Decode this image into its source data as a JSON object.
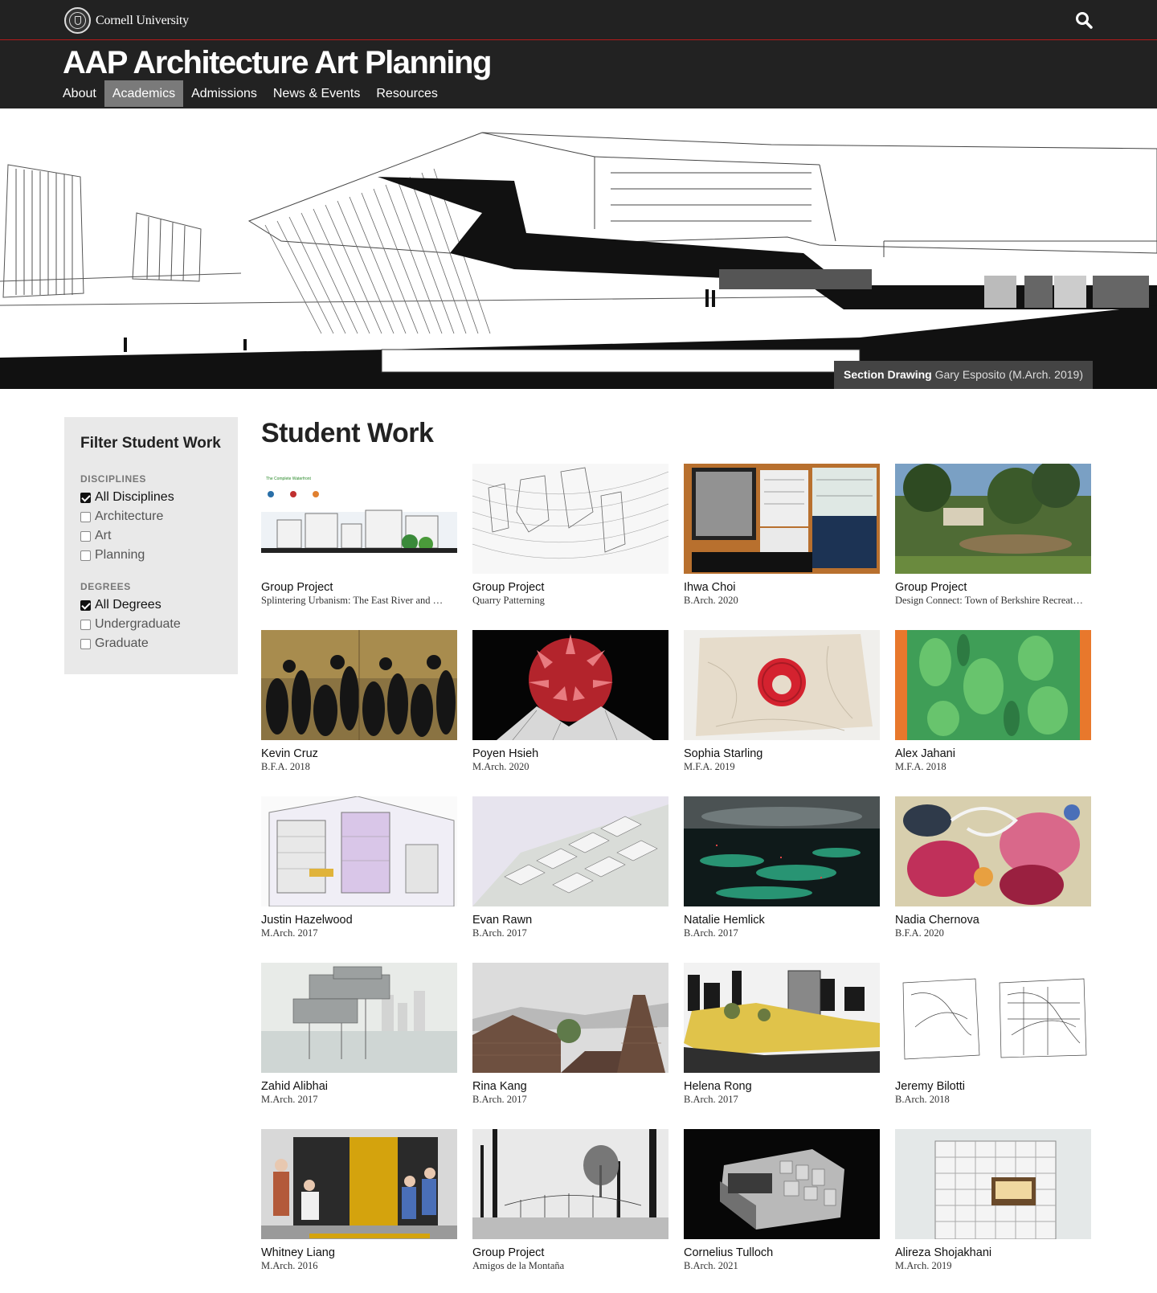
{
  "cornell": {
    "name": "Cornell University"
  },
  "header": {
    "title": "AAP Architecture Art Planning"
  },
  "nav": [
    {
      "label": "About",
      "active": false
    },
    {
      "label": "Academics",
      "active": true
    },
    {
      "label": "Admissions",
      "active": false
    },
    {
      "label": "News & Events",
      "active": false
    },
    {
      "label": "Resources",
      "active": false
    }
  ],
  "hero": {
    "caption_title": "Section Drawing",
    "caption_credit": "Gary Esposito (M.Arch. 2019)"
  },
  "filter": {
    "title": "Filter Student Work",
    "disciplines_heading": "DISCIPLINES",
    "disciplines": [
      {
        "label": "All Disciplines",
        "checked": true
      },
      {
        "label": "Architecture",
        "checked": false
      },
      {
        "label": "Art",
        "checked": false
      },
      {
        "label": "Planning",
        "checked": false
      }
    ],
    "degrees_heading": "DEGREES",
    "degrees": [
      {
        "label": "All Degrees",
        "checked": true
      },
      {
        "label": "Undergraduate",
        "checked": false
      },
      {
        "label": "Graduate",
        "checked": false
      }
    ]
  },
  "main": {
    "title": "Student Work"
  },
  "works": [
    {
      "name": "Group Project",
      "sub": "Splintering Urbanism: The East River and …",
      "theme": "waterfront"
    },
    {
      "name": "Group Project",
      "sub": "Quarry Patterning",
      "theme": "sketch"
    },
    {
      "name": "Ihwa Choi",
      "sub": "B.Arch. 2020",
      "theme": "table"
    },
    {
      "name": "Group Project",
      "sub": "Design Connect: Town of Berkshire Recreat…",
      "theme": "park"
    },
    {
      "name": "Kevin Cruz",
      "sub": "B.F.A. 2018",
      "theme": "shadow"
    },
    {
      "name": "Poyen Hsieh",
      "sub": "M.Arch. 2020",
      "theme": "spiky"
    },
    {
      "name": "Sophia Starling",
      "sub": "M.F.A. 2019",
      "theme": "cloth"
    },
    {
      "name": "Alex Jahani",
      "sub": "M.F.A. 2018",
      "theme": "paint"
    },
    {
      "name": "Justin Hazelwood",
      "sub": "M.Arch. 2017",
      "theme": "axon"
    },
    {
      "name": "Evan Rawn",
      "sub": "B.Arch. 2017",
      "theme": "aerial"
    },
    {
      "name": "Natalie Hemlick",
      "sub": "B.Arch. 2017",
      "theme": "night"
    },
    {
      "name": "Nadia Chernova",
      "sub": "B.F.A. 2020",
      "theme": "floral"
    },
    {
      "name": "Zahid Alibhai",
      "sub": "M.Arch. 2017",
      "theme": "harbor"
    },
    {
      "name": "Rina Kang",
      "sub": "B.Arch. 2017",
      "theme": "brick"
    },
    {
      "name": "Helena Rong",
      "sub": "B.Arch. 2017",
      "theme": "collage"
    },
    {
      "name": "Jeremy Bilotti",
      "sub": "B.Arch. 2018",
      "theme": "drawing"
    },
    {
      "name": "Whitney Liang",
      "sub": "M.Arch. 2016",
      "theme": "kiosk"
    },
    {
      "name": "Group Project",
      "sub": "Amigos de la Montaña",
      "theme": "forest"
    },
    {
      "name": "Cornelius Tulloch",
      "sub": "B.Arch. 2021",
      "theme": "model"
    },
    {
      "name": "Alireza Shojakhani",
      "sub": "M.Arch. 2019",
      "theme": "tower"
    }
  ]
}
